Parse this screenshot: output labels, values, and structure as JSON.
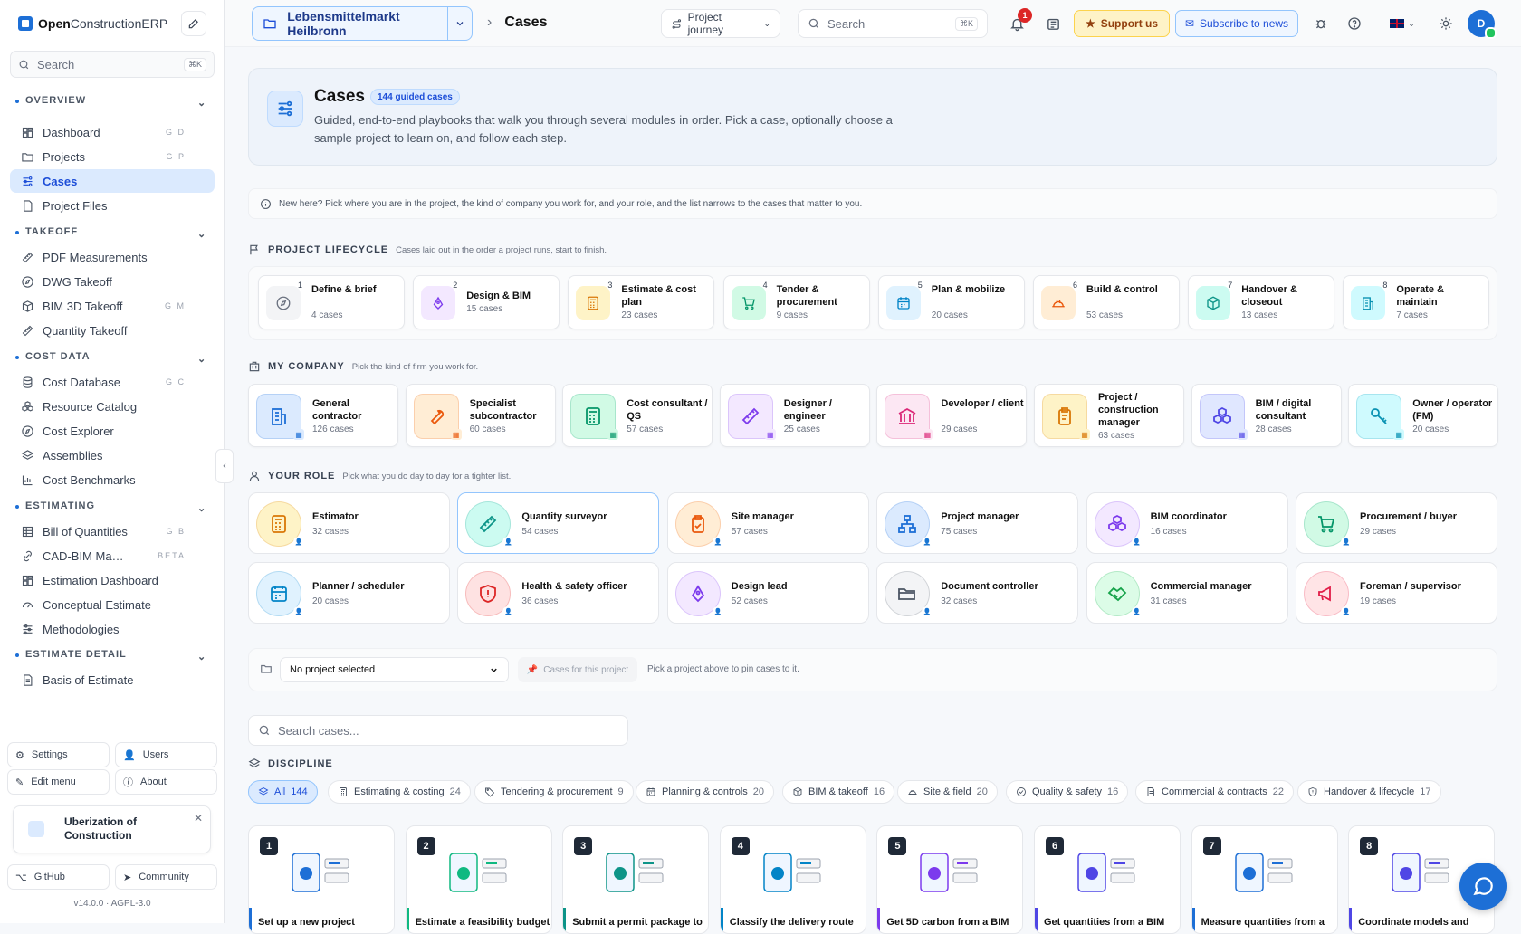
{
  "sidebar": {
    "brand_bold": "Open",
    "brand_rest": "ConstructionERP",
    "search_placeholder": "Search",
    "search_kbd": "⌘K",
    "sections": [
      {
        "title": "OVERVIEW",
        "items": [
          {
            "label": "Dashboard",
            "shortcut": "G D",
            "icon": "dashboard-icon"
          },
          {
            "label": "Projects",
            "shortcut": "G P",
            "icon": "folder-icon"
          },
          {
            "label": "Cases",
            "shortcut": "",
            "icon": "cases-icon",
            "active": true
          },
          {
            "label": "Project Files",
            "shortcut": "",
            "icon": "file-icon"
          }
        ]
      },
      {
        "title": "TAKEOFF",
        "items": [
          {
            "label": "PDF Measurements",
            "shortcut": "",
            "icon": "ruler-icon"
          },
          {
            "label": "DWG Takeoff",
            "shortcut": "",
            "icon": "compass-icon"
          },
          {
            "label": "BIM 3D Takeoff",
            "shortcut": "G M",
            "icon": "cube-icon"
          },
          {
            "label": "Quantity Takeoff",
            "shortcut": "",
            "icon": "ruler-icon"
          }
        ]
      },
      {
        "title": "COST DATA",
        "items": [
          {
            "label": "Cost Database",
            "shortcut": "G C",
            "icon": "database-icon"
          },
          {
            "label": "Resource Catalog",
            "shortcut": "",
            "icon": "boxes-icon"
          },
          {
            "label": "Cost Explorer",
            "shortcut": "",
            "icon": "explore-icon"
          },
          {
            "label": "Assemblies",
            "shortcut": "",
            "icon": "layers-icon"
          },
          {
            "label": "Cost Benchmarks",
            "shortcut": "",
            "icon": "bar-chart-icon"
          }
        ]
      },
      {
        "title": "ESTIMATING",
        "items": [
          {
            "label": "Bill of Quantities",
            "shortcut": "G B",
            "icon": "table-icon"
          },
          {
            "label": "CAD-BIM Ma…",
            "shortcut": "BETA",
            "icon": "link-icon"
          },
          {
            "label": "Estimation Dashboard",
            "shortcut": "",
            "icon": "dashboard-icon"
          },
          {
            "label": "Conceptual Estimate",
            "shortcut": "",
            "icon": "gauge-icon"
          },
          {
            "label": "Methodologies",
            "shortcut": "",
            "icon": "sliders-icon"
          }
        ]
      },
      {
        "title": "ESTIMATE DETAIL",
        "items": [
          {
            "label": "Basis of Estimate",
            "shortcut": "",
            "icon": "document-icon"
          }
        ]
      }
    ],
    "settings": "Settings",
    "users": "Users",
    "edit_menu": "Edit menu",
    "about": "About",
    "promo": "Uberization of Construction",
    "github": "GitHub",
    "community": "Community",
    "version": "v14.0.0 · AGPL-3.0"
  },
  "topbar": {
    "project": "Lebensmittelmarkt Heilbronn",
    "crumb": "Cases",
    "journey": "Project journey",
    "search_placeholder": "Search",
    "search_kbd": "⌘K",
    "notifications": "1",
    "support": "Support us",
    "subscribe": "Subscribe to news",
    "avatar": "D"
  },
  "hero": {
    "title": "Cases",
    "badge": "144 guided cases",
    "description": "Guided, end-to-end playbooks that walk you through several modules in order. Pick a case, optionally choose a sample project to learn on, and follow each step."
  },
  "info": "New here? Pick where you are in the project, the kind of company you work for, and your role, and the list narrows to the cases that matter to you.",
  "lifecycle": {
    "title": "PROJECT LIFECYCLE",
    "subtitle": "Cases laid out in the order a project runs, start to finish.",
    "items": [
      {
        "num": "1",
        "label": "Define & brief",
        "count": "4 cases",
        "color": "#6b7280",
        "bg": "#f3f4f6",
        "icon": "compass-icon"
      },
      {
        "num": "2",
        "label": "Design & BIM",
        "count": "15 cases",
        "color": "#7c3aed",
        "bg": "#f3e8ff",
        "icon": "pen-tool-icon"
      },
      {
        "num": "3",
        "label": "Estimate & cost plan",
        "count": "23 cases",
        "color": "#d97706",
        "bg": "#fef3c7",
        "icon": "calculator-icon"
      },
      {
        "num": "4",
        "label": "Tender & procurement",
        "count": "9 cases",
        "color": "#059669",
        "bg": "#d1fae5",
        "icon": "cart-icon"
      },
      {
        "num": "5",
        "label": "Plan & mobilize",
        "count": "20 cases",
        "color": "#0284c7",
        "bg": "#e0f2fe",
        "icon": "calendar-icon"
      },
      {
        "num": "6",
        "label": "Build & control",
        "count": "53 cases",
        "color": "#ea580c",
        "bg": "#ffedd5",
        "icon": "hardhat-icon"
      },
      {
        "num": "7",
        "label": "Handover & closeout",
        "count": "13 cases",
        "color": "#0d9488",
        "bg": "#ccfbf1",
        "icon": "package-icon"
      },
      {
        "num": "8",
        "label": "Operate & maintain",
        "count": "7 cases",
        "color": "#0891b2",
        "bg": "#cffafe",
        "icon": "building-icon"
      }
    ]
  },
  "company": {
    "title": "MY COMPANY",
    "subtitle": "Pick the kind of firm you work for.",
    "items": [
      {
        "label": "General contractor",
        "count": "126 cases",
        "color": "#1d6fd6",
        "bg": "#dbeafe",
        "icon": "building-icon"
      },
      {
        "label": "Specialist subcontractor",
        "count": "60 cases",
        "color": "#ea580c",
        "bg": "#ffedd5",
        "icon": "wrench-icon"
      },
      {
        "label": "Cost consultant / QS",
        "count": "57 cases",
        "color": "#059669",
        "bg": "#d1fae5",
        "icon": "calculator-icon"
      },
      {
        "label": "Designer / engineer",
        "count": "25 cases",
        "color": "#7c3aed",
        "bg": "#f3e8ff",
        "icon": "ruler-icon"
      },
      {
        "label": "Developer / client",
        "count": "29 cases",
        "color": "#db2777",
        "bg": "#fce7f3",
        "icon": "bank-icon"
      },
      {
        "label": "Project / construction manager",
        "count": "63 cases",
        "color": "#d97706",
        "bg": "#fef3c7",
        "icon": "clipboard-icon"
      },
      {
        "label": "BIM / digital consultant",
        "count": "28 cases",
        "color": "#4f46e5",
        "bg": "#e0e7ff",
        "icon": "boxes-icon"
      },
      {
        "label": "Owner / operator (FM)",
        "count": "20 cases",
        "color": "#0891b2",
        "bg": "#cffafe",
        "icon": "key-icon"
      }
    ]
  },
  "roles": {
    "title": "YOUR ROLE",
    "subtitle": "Pick what you do day to day for a tighter list.",
    "items": [
      {
        "label": "Estimator",
        "count": "32 cases",
        "color": "#d97706",
        "bg": "#fef3c7",
        "icon": "calculator-icon"
      },
      {
        "label": "Quantity surveyor",
        "count": "54 cases",
        "color": "#0d9488",
        "bg": "#ccfbf1",
        "icon": "ruler-icon",
        "selected": true
      },
      {
        "label": "Site manager",
        "count": "57 cases",
        "color": "#ea580c",
        "bg": "#ffedd5",
        "icon": "clipboard-check-icon"
      },
      {
        "label": "Project manager",
        "count": "75 cases",
        "color": "#1d6fd6",
        "bg": "#dbeafe",
        "icon": "network-icon"
      },
      {
        "label": "BIM coordinator",
        "count": "16 cases",
        "color": "#7c3aed",
        "bg": "#f3e8ff",
        "icon": "boxes-icon"
      },
      {
        "label": "Procurement / buyer",
        "count": "29 cases",
        "color": "#059669",
        "bg": "#d1fae5",
        "icon": "cart-icon"
      },
      {
        "label": "Planner / scheduler",
        "count": "20 cases",
        "color": "#0284c7",
        "bg": "#e0f2fe",
        "icon": "calendar-icon"
      },
      {
        "label": "Health & safety officer",
        "count": "36 cases",
        "color": "#dc2626",
        "bg": "#fee2e2",
        "icon": "shield-icon"
      },
      {
        "label": "Design lead",
        "count": "52 cases",
        "color": "#7c3aed",
        "bg": "#f3e8ff",
        "icon": "pen-tool-icon"
      },
      {
        "label": "Document controller",
        "count": "32 cases",
        "color": "#4b5563",
        "bg": "#f3f4f6",
        "icon": "folder-open-icon"
      },
      {
        "label": "Commercial manager",
        "count": "31 cases",
        "color": "#16a34a",
        "bg": "#dcfce7",
        "icon": "handshake-icon"
      },
      {
        "label": "Foreman / supervisor",
        "count": "19 cases",
        "color": "#e11d48",
        "bg": "#ffe4e6",
        "icon": "megaphone-icon"
      }
    ]
  },
  "project_select": {
    "value": "No project selected",
    "pin_label": "Cases for this project",
    "hint": "Pick a project above to pin cases to it."
  },
  "case_search_placeholder": "Search cases...",
  "discipline": {
    "title": "DISCIPLINE",
    "chips": [
      {
        "label": "All",
        "count": "144",
        "active": true,
        "icon": "layers-icon"
      },
      {
        "label": "Estimating & costing",
        "count": "24",
        "icon": "calculator-icon"
      },
      {
        "label": "Tendering & procurement",
        "count": "9",
        "icon": "tag-icon"
      },
      {
        "label": "Planning & controls",
        "count": "20",
        "icon": "calendar-icon"
      },
      {
        "label": "BIM & takeoff",
        "count": "16",
        "icon": "cube-icon"
      },
      {
        "label": "Site & field",
        "count": "20",
        "icon": "hardhat-icon"
      },
      {
        "label": "Quality & safety",
        "count": "16",
        "icon": "check-circle-icon"
      },
      {
        "label": "Commercial & contracts",
        "count": "22",
        "icon": "document-icon"
      },
      {
        "label": "Handover & lifecycle",
        "count": "17",
        "icon": "shield-icon"
      }
    ]
  },
  "cases": [
    {
      "num": "1",
      "title": "Set up a new project"
    },
    {
      "num": "2",
      "title": "Estimate a feasibility budget"
    },
    {
      "num": "3",
      "title": "Submit a permit package to"
    },
    {
      "num": "4",
      "title": "Classify the delivery route"
    },
    {
      "num": "5",
      "title": "Get 5D carbon from a BIM"
    },
    {
      "num": "6",
      "title": "Get quantities from a BIM"
    },
    {
      "num": "7",
      "title": "Measure quantities from a"
    },
    {
      "num": "8",
      "title": "Coordinate models and"
    }
  ]
}
